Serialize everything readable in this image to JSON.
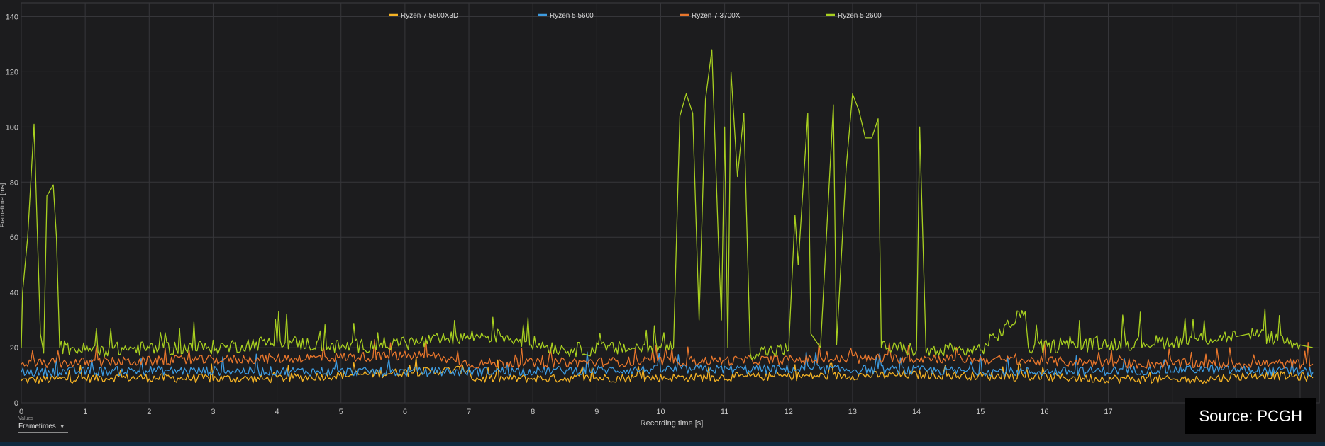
{
  "chart_data": {
    "type": "line",
    "xlabel": "Recording time [s]",
    "ylabel": "Frametime [ms]",
    "xlim": [
      0,
      20.3
    ],
    "ylim": [
      0,
      145
    ],
    "x_ticks": [
      0,
      1,
      2,
      3,
      4,
      5,
      6,
      7,
      8,
      9,
      10,
      11,
      12,
      13,
      14,
      15,
      16,
      17
    ],
    "y_ticks": [
      0,
      20,
      40,
      60,
      80,
      100,
      120,
      140
    ],
    "grid": true,
    "legend_position": "top-center",
    "series": [
      {
        "name": "Ryzen 7 5800X3D",
        "color": "#f5b324",
        "base": 8.5,
        "noise": 1.6,
        "points": [
          [
            0,
            8
          ],
          [
            1.4,
            9
          ],
          [
            3.8,
            8.5
          ],
          [
            7,
            12
          ],
          [
            7.05,
            8.5
          ],
          [
            10.4,
            9
          ],
          [
            14.1,
            10
          ],
          [
            18.3,
            8
          ],
          [
            19.4,
            10
          ],
          [
            20.2,
            9
          ]
        ]
      },
      {
        "name": "Ryzen 5 5600",
        "color": "#3d9be0",
        "base": 11,
        "noise": 1.7,
        "points": [
          [
            0,
            11
          ],
          [
            2,
            11.5
          ],
          [
            6.4,
            11
          ],
          [
            10.5,
            12
          ],
          [
            12.5,
            12
          ],
          [
            16,
            11
          ],
          [
            18.4,
            12
          ],
          [
            20.2,
            11
          ]
        ]
      },
      {
        "name": "Ryzen 7 3700X",
        "color": "#e8762c",
        "base": 13.5,
        "noise": 1.8,
        "points": [
          [
            0,
            14
          ],
          [
            6.4,
            17
          ],
          [
            7,
            14
          ],
          [
            10.5,
            15
          ],
          [
            14.3,
            16
          ],
          [
            17.5,
            14
          ],
          [
            20.2,
            14
          ]
        ]
      },
      {
        "name": "Ryzen 5 2600",
        "color": "#a8d020",
        "base": 19,
        "noise": 2.6,
        "points": [
          [
            0,
            20
          ],
          [
            0.02,
            40
          ],
          [
            0.1,
            60
          ],
          [
            0.2,
            101
          ],
          [
            0.3,
            25
          ],
          [
            0.35,
            18
          ],
          [
            0.4,
            75
          ],
          [
            0.5,
            79
          ],
          [
            0.55,
            60
          ],
          [
            0.6,
            20
          ],
          [
            1.0,
            19
          ],
          [
            3.2,
            20
          ],
          [
            4.0,
            22
          ],
          [
            5.0,
            20
          ],
          [
            6.4,
            22
          ],
          [
            7.1,
            24
          ],
          [
            7.5,
            24
          ],
          [
            8.5,
            19
          ],
          [
            10.2,
            20
          ],
          [
            10.3,
            104
          ],
          [
            10.4,
            112
          ],
          [
            10.5,
            105
          ],
          [
            10.6,
            30
          ],
          [
            10.7,
            110
          ],
          [
            10.8,
            128
          ],
          [
            10.9,
            60
          ],
          [
            10.95,
            30
          ],
          [
            11.0,
            100
          ],
          [
            11.05,
            20
          ],
          [
            11.1,
            120
          ],
          [
            11.2,
            82
          ],
          [
            11.3,
            105
          ],
          [
            11.4,
            18
          ],
          [
            12.0,
            19
          ],
          [
            12.1,
            68
          ],
          [
            12.15,
            50
          ],
          [
            12.3,
            105
          ],
          [
            12.35,
            25
          ],
          [
            12.5,
            20
          ],
          [
            12.7,
            108
          ],
          [
            12.75,
            21
          ],
          [
            12.9,
            85
          ],
          [
            13.0,
            112
          ],
          [
            13.1,
            106
          ],
          [
            13.2,
            96
          ],
          [
            13.3,
            96
          ],
          [
            13.4,
            103
          ],
          [
            13.45,
            20
          ],
          [
            14.0,
            19
          ],
          [
            14.05,
            100
          ],
          [
            14.15,
            18
          ],
          [
            15.0,
            19
          ],
          [
            15.7,
            33
          ],
          [
            15.75,
            20
          ],
          [
            17.0,
            21
          ],
          [
            18.0,
            22
          ],
          [
            19.0,
            24
          ],
          [
            19.2,
            25
          ],
          [
            20.0,
            21
          ],
          [
            20.2,
            20
          ]
        ]
      }
    ]
  },
  "ui": {
    "value_caption": "Values",
    "value_select": "Frametimes",
    "source": "Source: PCGH"
  }
}
